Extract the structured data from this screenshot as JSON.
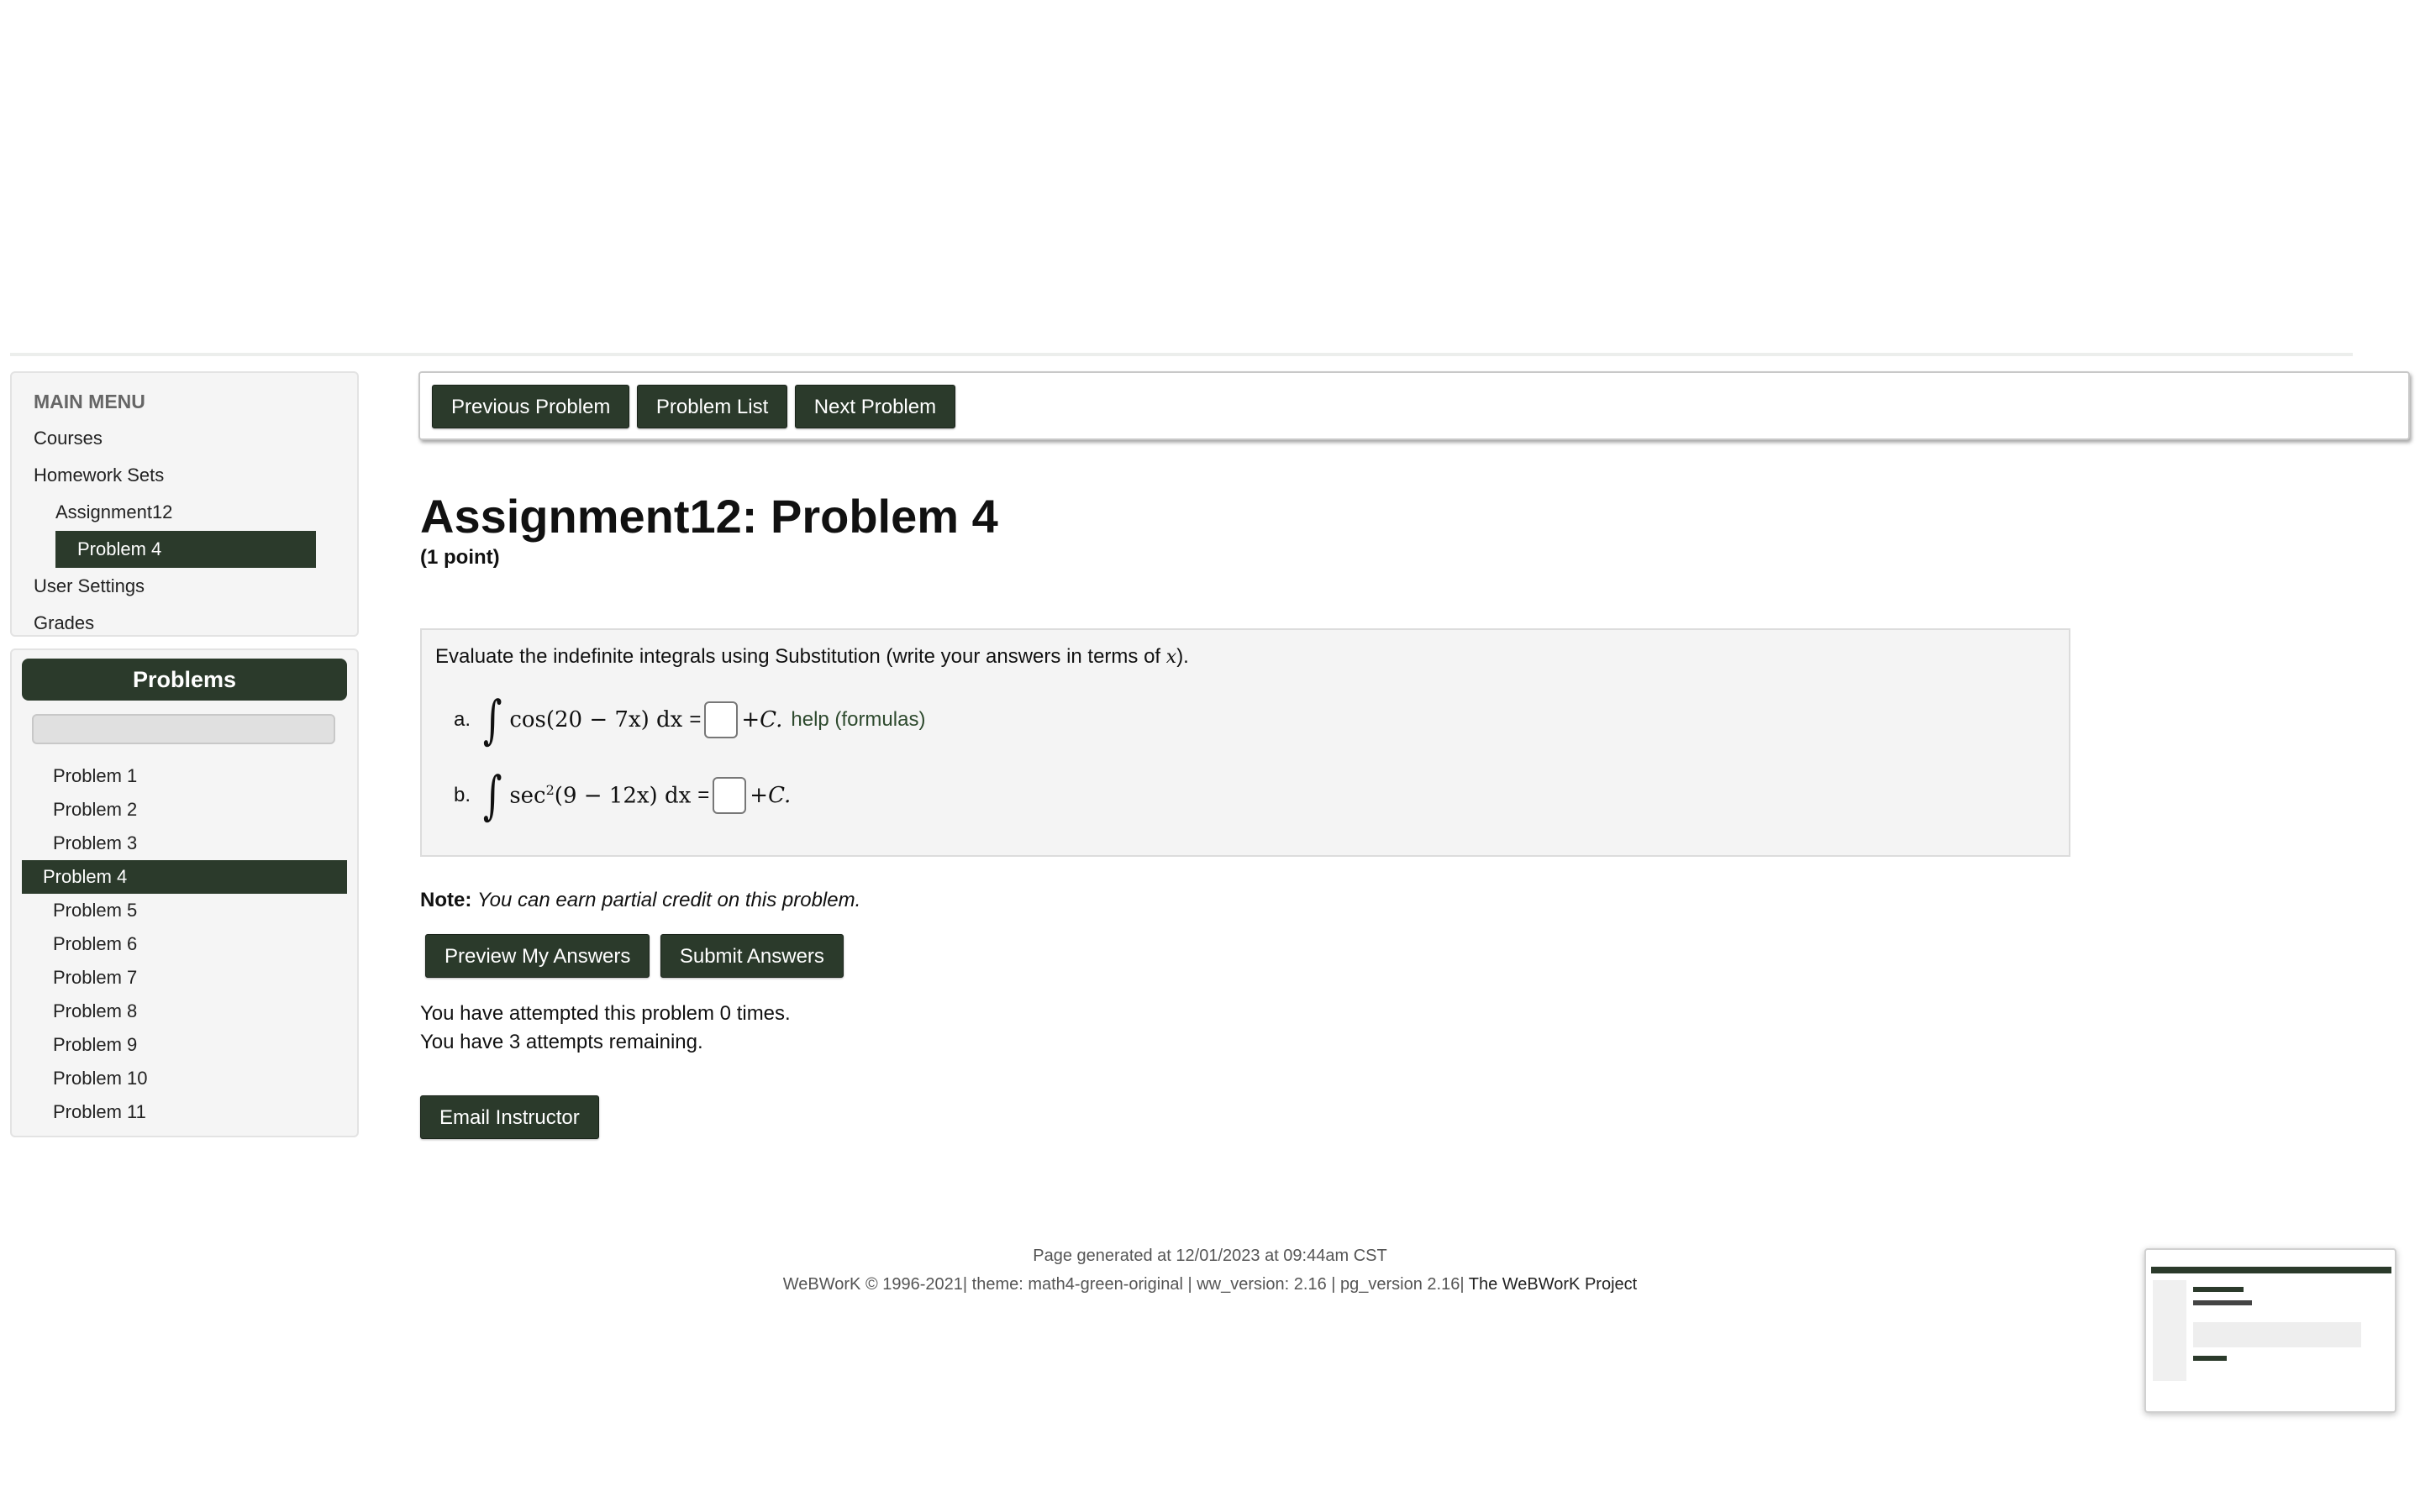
{
  "sidebar": {
    "menu_header": "MAIN MENU",
    "menu_items": [
      {
        "label": "Courses"
      },
      {
        "label": "Homework Sets"
      },
      {
        "label": "Assignment12"
      },
      {
        "label": "Problem 4"
      },
      {
        "label": "User Settings"
      },
      {
        "label": "Grades"
      }
    ],
    "problems_header": "Problems",
    "problems": [
      "Problem 1",
      "Problem 2",
      "Problem 3",
      "Problem 4",
      "Problem 5",
      "Problem 6",
      "Problem 7",
      "Problem 8",
      "Problem 9",
      "Problem 10",
      "Problem 11"
    ],
    "active_problem": "Problem 4"
  },
  "nav": {
    "previous": "Previous Problem",
    "list": "Problem List",
    "next": "Next Problem"
  },
  "problem": {
    "title": "Assignment12: Problem 4",
    "points": "(1 point)",
    "statement_prefix": "Evaluate the indefinite integrals using Substitution (write your answers in terms of ",
    "statement_var": "x",
    "statement_suffix": ").",
    "part_a": {
      "label": "a.",
      "integral": "∫",
      "expression": "cos(20 − 7x) dx",
      "equals": "=",
      "plus_c": "+C.",
      "help": "help (formulas)"
    },
    "part_b": {
      "label": "b.",
      "integral": "∫",
      "expression_pre": "sec",
      "expression_sup": "2",
      "expression_post": "(9 − 12x) dx",
      "equals": "=",
      "plus_c": "+C."
    }
  },
  "note": {
    "label": "Note:",
    "text": "You can earn partial credit on this problem."
  },
  "actions": {
    "preview": "Preview My Answers",
    "submit": "Submit Answers",
    "email": "Email Instructor"
  },
  "attempts": {
    "line1": "You have attempted this problem 0 times.",
    "line2": "You have 3 attempts remaining."
  },
  "footer": {
    "line1": "Page generated at 12/01/2023 at 09:44am CST",
    "line2": "WeBWorK © 1996-2021| theme: math4-green-original | ww_version: 2.16 | pg_version 2.16|",
    "project_link": "The WeBWorK Project"
  },
  "colors": {
    "accent": "#2b3a2b"
  }
}
